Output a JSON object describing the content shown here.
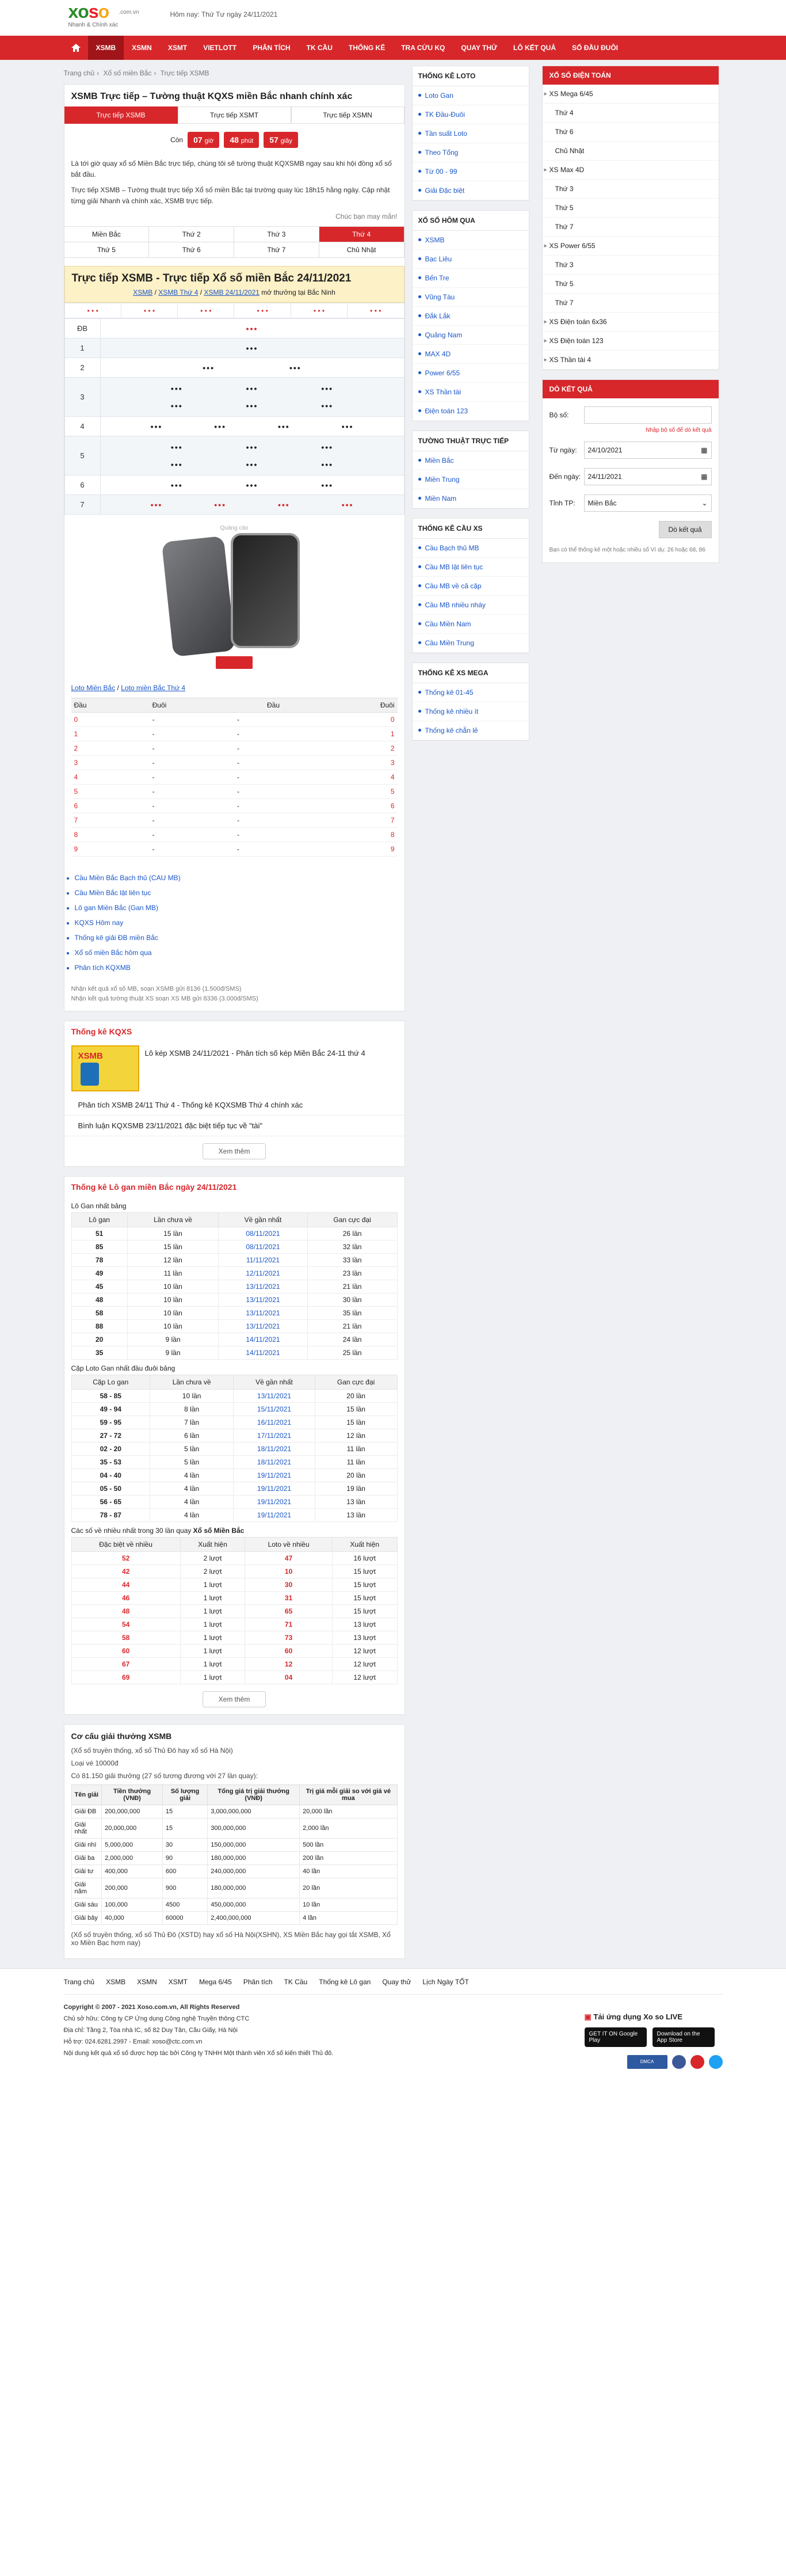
{
  "header": {
    "logo_x": "xo",
    "logo_s": "s",
    "logo_o": "o",
    "logo_dom": ".com.vn",
    "logo_slogan": "Nhanh & Chính xác",
    "date": "Hôm nay: Thứ Tư ngày 24/11/2021"
  },
  "nav": [
    "XSMB",
    "XSMN",
    "XSMT",
    "VIETLOTT",
    "PHÂN TÍCH",
    "TK CẦU",
    "THỐNG KÊ",
    "TRA CỨU KQ",
    "QUAY THỬ",
    "LÔ KẾT QUẢ",
    "SỔ ĐẦU ĐUÔI"
  ],
  "breadcrumb": [
    "Trang chủ",
    "Xổ số miền Bắc",
    "Trực tiếp XSMB"
  ],
  "main": {
    "title": "XSMB Trực tiếp – Tường thuật KQXS miền Bắc nhanh chính xác",
    "tabs": [
      "Trực tiếp XSMB",
      "Trực tiếp XSMT",
      "Trực tiếp XSMN"
    ],
    "countdown": {
      "label": "Còn",
      "h": "07",
      "hu": "giờ",
      "m": "48",
      "mu": "phút",
      "s": "57",
      "su": "giây"
    },
    "intro1": "Là tới giờ quay xổ số Miền Bắc trực tiếp, chúng tôi sẽ tường thuật KQXSMB ngay sau khi hội đồng xổ số bắt đầu.",
    "intro2": "Trực tiếp XSMB – Tường thuật trực tiếp Xổ số miền Bắc tại trường quay lúc 18h15 hằng ngày. Cập nhật từng giải Nhanh và chính xác, XSMB trực tiếp.",
    "more": "Chúc bạn may mắn!",
    "days": [
      "Miền Bắc",
      "Thứ 2",
      "Thứ 3",
      "Thứ 4",
      "Thứ 5",
      "Thứ 6",
      "Thứ 7",
      "Chủ Nhật"
    ],
    "kq_title": "Trực tiếp XSMB - Trực tiếp Xổ số miền Bắc 24/11/2021",
    "kq_sub1": "XSMB",
    "kq_sub2": "XSMB Thứ 4",
    "kq_sub3": "XSMB 24/11/2021",
    "kq_sub4": " mở thưởng tại Bắc Ninh",
    "prize_labels": [
      "ĐB",
      "1",
      "2",
      "3",
      "4",
      "5",
      "6",
      "7"
    ],
    "ad_label": "Quảng cáo",
    "loto_links": [
      "Loto Miền Bắc",
      "Loto miền Bắc Thứ 4"
    ],
    "loto_head": [
      "Đầu",
      "Đuôi",
      "Đầu",
      "Đuôi"
    ],
    "links": [
      "Cầu Miền Bắc Bạch thủ (CAU MB)",
      "Cầu Miền Bắc lật liên tục",
      "Lô gan Miền Bắc (Gan MB)",
      "KQXS Hôm nay",
      "Thống kê giải ĐB miền Bắc",
      "Xổ số miền Bắc hôm qua",
      "Phân tích KQXMB"
    ],
    "note1": "Nhận kết quả xổ số MB, soạn XSMB gửi 8136 (1.500đ/SMS)",
    "note2": "Nhận kết quả tường thuật XS soạn XS MB gửi 8336 (3.000đ/SMS)"
  },
  "kqxs": {
    "title": "Thống kê KQXS",
    "post": "Lô kép XSMB 24/11/2021 - Phân tích số kép Miền Bắc 24-11 thứ 4",
    "thumb": "XSMB",
    "links": [
      "Phân tích XSMB 24/11 Thứ 4 - Thống kê KQXSMB Thứ 4 chính xác",
      "Bình luận KQXSMB 23/11/2021 đặc biệt tiếp tục về \"tài\""
    ],
    "btn": "Xem thêm"
  },
  "logan": {
    "title": "Thống kê Lô gan miền Bắc ngày 24/11/2021",
    "cap1": "Lô Gan nhất bảng",
    "cap2": "Cặp Loto Gan nhất đầu đuôi bảng",
    "cap3": "Các số về nhiều nhất trong 30 lần quay ",
    "cap3b": "Xổ số Miền Bắc",
    "h1": [
      "Lô gan",
      "Lần chưa về",
      "Về gần nhất",
      "Gan cực đại"
    ],
    "r1": [
      [
        "51",
        "15 lần",
        "08/11/2021",
        "26 lần"
      ],
      [
        "85",
        "15 lần",
        "08/11/2021",
        "32 lần"
      ],
      [
        "78",
        "12 lần",
        "11/11/2021",
        "33 lần"
      ],
      [
        "49",
        "11 lần",
        "12/11/2021",
        "23 lần"
      ],
      [
        "45",
        "10 lần",
        "13/11/2021",
        "21 lần"
      ],
      [
        "48",
        "10 lần",
        "13/11/2021",
        "30 lần"
      ],
      [
        "58",
        "10 lần",
        "13/11/2021",
        "35 lần"
      ],
      [
        "88",
        "10 lần",
        "13/11/2021",
        "21 lần"
      ],
      [
        "20",
        "9 lần",
        "14/11/2021",
        "24 lần"
      ],
      [
        "35",
        "9 lần",
        "14/11/2021",
        "25 lần"
      ]
    ],
    "h2": [
      "Cặp Lo gan",
      "Lần chưa về",
      "Về gần nhất",
      "Gan cực đại"
    ],
    "r2": [
      [
        "58 - 85",
        "10 lần",
        "13/11/2021",
        "20 lần"
      ],
      [
        "49 - 94",
        "8 lần",
        "15/11/2021",
        "15 lần"
      ],
      [
        "59 - 95",
        "7 lần",
        "16/11/2021",
        "15 lần"
      ],
      [
        "27 - 72",
        "6 lần",
        "17/11/2021",
        "12 lần"
      ],
      [
        "02 - 20",
        "5 lần",
        "18/11/2021",
        "11 lần"
      ],
      [
        "35 - 53",
        "5 lần",
        "18/11/2021",
        "11 lần"
      ],
      [
        "04 - 40",
        "4 lần",
        "19/11/2021",
        "20 lần"
      ],
      [
        "05 - 50",
        "4 lần",
        "19/11/2021",
        "19 lần"
      ],
      [
        "56 - 65",
        "4 lần",
        "19/11/2021",
        "13 lần"
      ],
      [
        "78 - 87",
        "4 lần",
        "19/11/2021",
        "13 lần"
      ]
    ],
    "h3": [
      "Đặc biệt về nhiều",
      "Xuất hiện",
      "Loto về nhiều",
      "Xuất hiện"
    ],
    "r3": [
      [
        "52",
        "2 lượt",
        "47",
        "16 lượt"
      ],
      [
        "42",
        "2 lượt",
        "10",
        "15 lượt"
      ],
      [
        "44",
        "1 lượt",
        "30",
        "15 lượt"
      ],
      [
        "46",
        "1 lượt",
        "31",
        "15 lượt"
      ],
      [
        "48",
        "1 lượt",
        "65",
        "15 lượt"
      ],
      [
        "54",
        "1 lượt",
        "71",
        "13 lượt"
      ],
      [
        "58",
        "1 lượt",
        "73",
        "13 lượt"
      ],
      [
        "60",
        "1 lượt",
        "60",
        "12 lượt"
      ],
      [
        "67",
        "1 lượt",
        "12",
        "12 lượt"
      ],
      [
        "69",
        "1 lượt",
        "04",
        "12 lượt"
      ]
    ],
    "btn": "Xem thêm"
  },
  "cocau": {
    "title": "Cơ cấu giải thưởng XSMB",
    "p1": "(Xổ số truyền thống, xổ số Thủ Đô hay xổ số Hà Nội)",
    "p2": "Loại vé 10000đ",
    "p3": "Có 81.150 giải thưởng (27 số tương đương với 27 lần quay):",
    "head": [
      "Tên giải",
      "Tiền thưởng (VNĐ)",
      "Số lượng giải",
      "Tổng giá trị giải thưởng (VNĐ)",
      "Trị giá mỗi giải so với giá vé mua"
    ],
    "rows": [
      [
        "Giải ĐB",
        "200,000,000",
        "15",
        "3,000,000,000",
        "20,000 lần"
      ],
      [
        "Giải nhất",
        "20,000,000",
        "15",
        "300,000,000",
        "2,000 lần"
      ],
      [
        "Giải nhì",
        "5,000,000",
        "30",
        "150,000,000",
        "500 lần"
      ],
      [
        "Giải ba",
        "2,000,000",
        "90",
        "180,000,000",
        "200 lần"
      ],
      [
        "Giải tư",
        "400,000",
        "600",
        "240,000,000",
        "40 lần"
      ],
      [
        "Giải năm",
        "200,000",
        "900",
        "180,000,000",
        "20 lần"
      ],
      [
        "Giải sáu",
        "100,000",
        "4500",
        "450,000,000",
        "10 lần"
      ],
      [
        "Giải bảy",
        "40,000",
        "60000",
        "2,400,000,000",
        "4 lần"
      ]
    ],
    "foot": "(Xổ số truyền thống, xổ số Thủ Đô (XSTD) hay xổ số Hà Nội(XSHN), XS Miền Bắc hay gọi tắt XSMB, Xổ xo Miền Bạc hơm nay)"
  },
  "sideM": [
    {
      "title": "THỐNG KÊ LOTO",
      "items": [
        "Loto Gan",
        "TK Đầu-Đuôi",
        "Tần suất Loto",
        "Theo Tổng",
        "Từ 00 - 99",
        "Giải Đặc biệt"
      ]
    },
    {
      "title": "XỔ SỐ HÔM QUA",
      "items": [
        "XSMB",
        "Bạc Liêu",
        "Bến Tre",
        "Vũng Tàu",
        "Đắk Lắk",
        "Quảng Nam",
        "MAX 4D",
        "Power 6/55",
        "XS Thần tài",
        "Điện toán 123"
      ]
    },
    {
      "title": "TƯỜNG THUẬT TRỰC TIẾP",
      "items": [
        "Miền Bắc",
        "Miền Trung",
        "Miền Nam"
      ]
    },
    {
      "title": "THỐNG KÊ CẦU XS",
      "items": [
        "Cầu Bạch thủ MB",
        "Cầu MB lật liên tục",
        "Cầu MB về cả cặp",
        "Cầu MB nhiều nháy",
        "Cầu Miền Nam",
        "Cầu Miền Trung"
      ]
    },
    {
      "title": "THỐNG KÊ XS MEGA",
      "items": [
        "Thống kê 01-45",
        "Thống kê nhiều ít",
        "Thống kê chẵn lẻ"
      ]
    }
  ],
  "sideR": {
    "title": "XỔ SỐ ĐIỆN TOÁN",
    "items": [
      [
        "XS Mega 6/45",
        1
      ],
      [
        "Thứ 4",
        0
      ],
      [
        "Thứ 6",
        0
      ],
      [
        "Chủ Nhật",
        0
      ],
      [
        "XS Max 4D",
        1
      ],
      [
        "Thứ 3",
        0
      ],
      [
        "Thứ 5",
        0
      ],
      [
        "Thứ 7",
        0
      ],
      [
        "XS Power 6/55",
        1
      ],
      [
        "Thứ 3",
        0
      ],
      [
        "Thứ 5",
        0
      ],
      [
        "Thứ 7",
        0
      ],
      [
        "XS Điện toán 6x36",
        1
      ],
      [
        "XS Điện toán 123",
        1
      ],
      [
        "XS Thần tài 4",
        1
      ]
    ]
  },
  "dokq": {
    "title": "DÒ KẾT QUẢ",
    "l1": "Bộ số:",
    "hint": "Nhập bộ số để dò kết quả",
    "l2": "Từ ngày:",
    "v2": "24/10/2021",
    "l3": "Đến ngày:",
    "v3": "24/11/2021",
    "l4": "Tỉnh TP:",
    "v4": "Miền Bắc",
    "btn": "Dò kết quả",
    "ft": "Bạn có thể thống kê một hoặc nhiều số Ví dụ: 26 hoặc 68, 86"
  },
  "footer": {
    "links": [
      "Trang chủ",
      "XSMB",
      "XSMN",
      "XSMT",
      "Mega 6/45",
      "Phân tích",
      "TK Cầu",
      "Thống kê Lô gan",
      "Quay thử",
      "Lịch Ngày TỐT"
    ],
    "copy": "Copyright © 2007 - 2021 Xoso.com.vn, All Rights Reserved",
    "i1": "Chủ sở hữu: Công ty CP Ứng dụng Công nghệ Truyền thông CTC",
    "i2": "Địa chỉ: Tầng 2, Tòa nhà IC, số 82 Duy Tân, Cầu Giấy, Hà Nội",
    "i3": "Hỗ trợ: 024.6281.2997 - Email: xoso@ctc.com.vn",
    "i4": "Nội dung kết quả xổ số được hợp tác bởi Công ty TNHH Một thành viên Xổ số kiến thiết Thủ đô.",
    "app": "Tải ứng dụng Xo so LIVE",
    "gp": "GET IT ON Google Play",
    "as": "Download on the App Store",
    "dmca": "DMCA PROTECTED"
  }
}
